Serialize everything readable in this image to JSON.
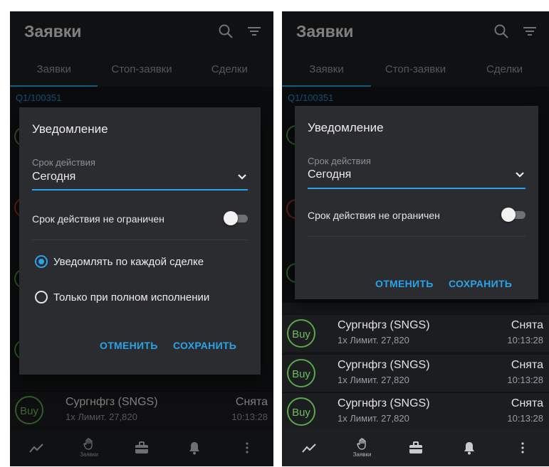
{
  "header": {
    "title": "Заявки"
  },
  "tabs": [
    {
      "label": "Заявки"
    },
    {
      "label": "Стоп-заявки"
    },
    {
      "label": "Сделки"
    }
  ],
  "account": "Q1/100351",
  "order": {
    "side": "Buy",
    "ticker": "Сургнфгз (SNGS)",
    "details": "1х Лимит. 27,820",
    "status": "Снята",
    "time": "10:13:28"
  },
  "bottom_nav": {
    "orders_label": "Заявки"
  },
  "dialog": {
    "title": "Уведомление",
    "validity_label": "Срок действия",
    "validity_value": "Сегодня",
    "unlimited_label": "Срок действия не ограничен",
    "unlimited_on": false,
    "radio_each_deal": "Уведомлять по каждой сделке",
    "radio_full": "Только при полном исполнении",
    "cancel": "ОТМЕНИТЬ",
    "save": "СОХРАНИТЬ"
  },
  "colors": {
    "accent": "#2aa3e8",
    "buy": "#5aa84a",
    "sell": "#c0392b",
    "background": "#151618"
  }
}
